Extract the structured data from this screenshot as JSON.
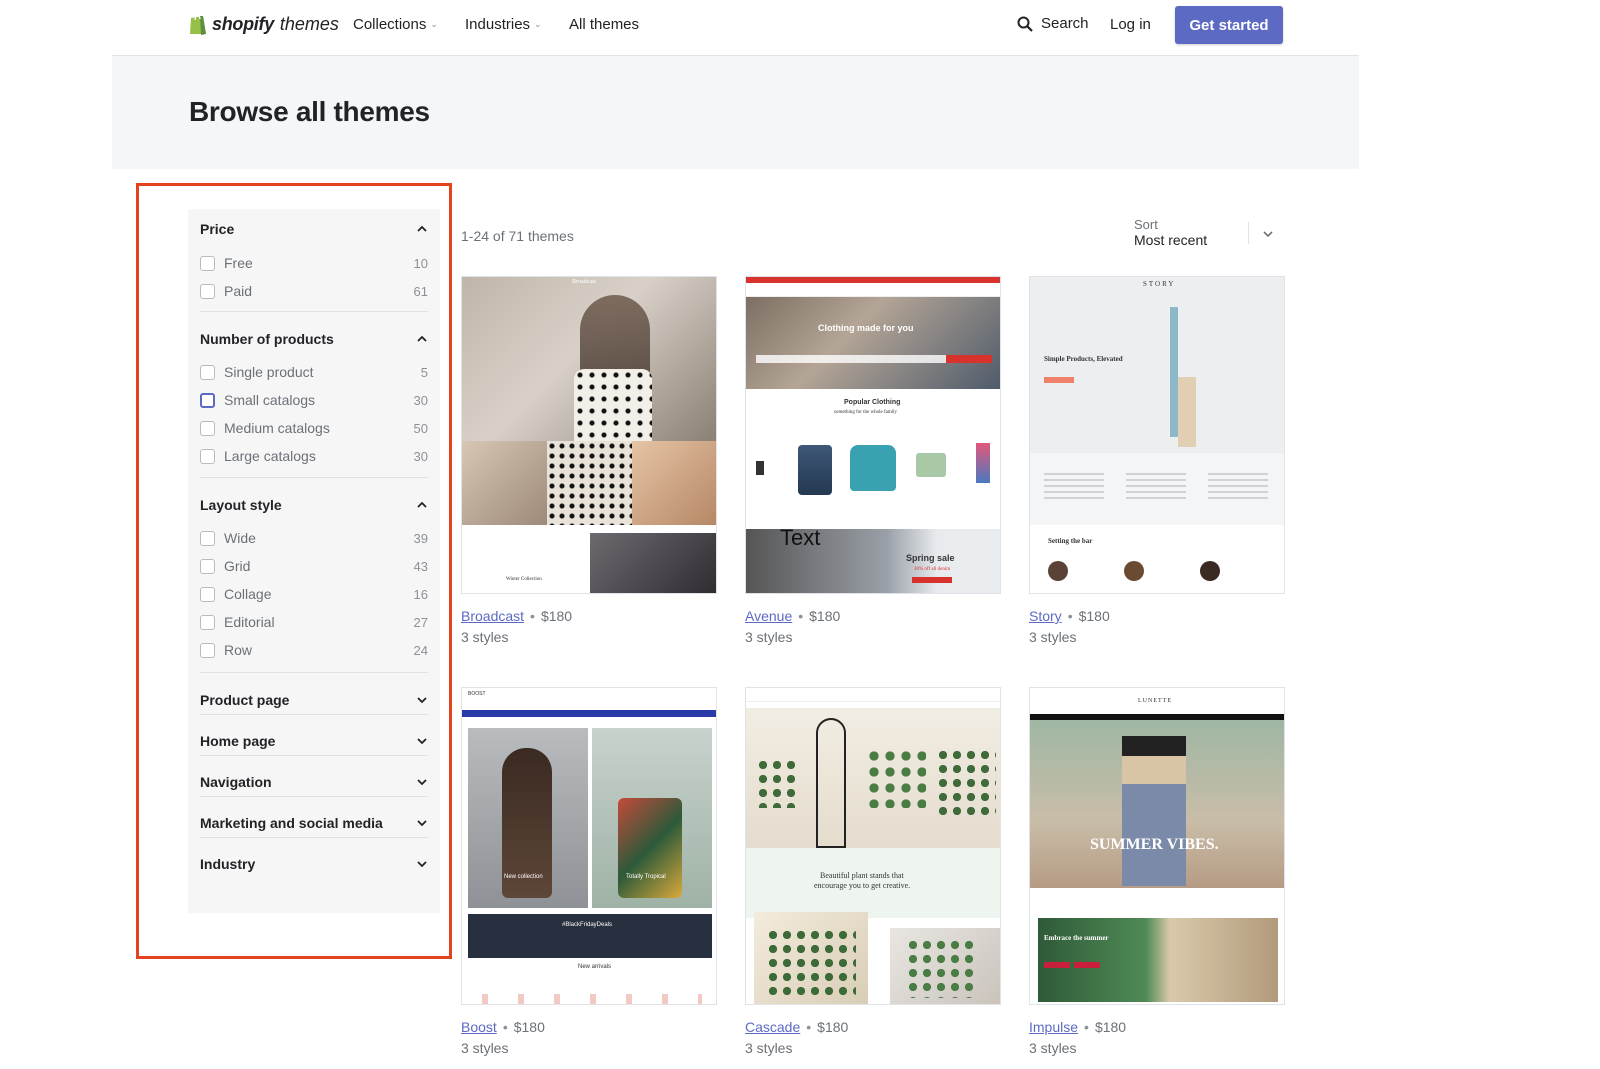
{
  "header": {
    "brand": "shopify",
    "brand_suffix": "themes",
    "nav": [
      {
        "label": "Collections",
        "has_caret": true
      },
      {
        "label": "Industries",
        "has_caret": true
      },
      {
        "label": "All themes",
        "has_caret": false
      }
    ],
    "search_label": "Search",
    "login_label": "Log in",
    "cta_label": "Get started"
  },
  "hero": {
    "title": "Browse all themes"
  },
  "filters": {
    "groups": [
      {
        "title": "Price",
        "expanded": true,
        "options": [
          {
            "label": "Free",
            "count": "10",
            "checked": false
          },
          {
            "label": "Paid",
            "count": "61",
            "checked": false
          }
        ]
      },
      {
        "title": "Number of products",
        "expanded": true,
        "options": [
          {
            "label": "Single product",
            "count": "5",
            "checked": false
          },
          {
            "label": "Small catalogs",
            "count": "30",
            "checked": false,
            "focused": true
          },
          {
            "label": "Medium catalogs",
            "count": "50",
            "checked": false
          },
          {
            "label": "Large catalogs",
            "count": "30",
            "checked": false
          }
        ]
      },
      {
        "title": "Layout style",
        "expanded": true,
        "options": [
          {
            "label": "Wide",
            "count": "39",
            "checked": false
          },
          {
            "label": "Grid",
            "count": "43",
            "checked": false
          },
          {
            "label": "Collage",
            "count": "16",
            "checked": false
          },
          {
            "label": "Editorial",
            "count": "27",
            "checked": false
          },
          {
            "label": "Row",
            "count": "24",
            "checked": false
          }
        ]
      }
    ],
    "collapsed": [
      "Product page",
      "Home page",
      "Navigation",
      "Marketing and social media",
      "Industry"
    ]
  },
  "results": {
    "count_text": "1-24 of 71 themes",
    "sort_label": "Sort",
    "sort_value": "Most recent"
  },
  "themes": [
    {
      "name": "Broadcast",
      "price": "$180",
      "styles": "3 styles"
    },
    {
      "name": "Avenue",
      "price": "$180",
      "styles": "3 styles"
    },
    {
      "name": "Story",
      "price": "$180",
      "styles": "3 styles"
    },
    {
      "name": "Boost",
      "price": "$180",
      "styles": "3 styles"
    },
    {
      "name": "Cascade",
      "price": "$180",
      "styles": "3 styles"
    },
    {
      "name": "Impulse",
      "price": "$180",
      "styles": "3 styles"
    }
  ],
  "thumb_text": {
    "avenue_hero": "Clothing made for you",
    "avenue_section": "Popular Clothing",
    "avenue_section_sub": "something for the whole family",
    "avenue_banner_word": "Text",
    "avenue_sale": "Spring sale",
    "avenue_sale_sub": "30% off all denim",
    "story_logo": "STORY",
    "story_heading": "Simple Products, Elevated",
    "story_footer": "Setting the bar",
    "boost_logo": "BOOST",
    "boost_tag1": "New collection",
    "boost_tag2": "Totally Tropical",
    "boost_banner": "#BlackFridayDeals",
    "boost_arrivals": "New arrivals",
    "cascade_text1": "Beautiful plant stands that",
    "cascade_text2": "encourage you to get creative.",
    "impulse_logo": "LUNETTE",
    "impulse_hero": "SUMMER VIBES.",
    "impulse_promo": "Embrace the summer",
    "broadcast_title": "Broadcast",
    "broadcast_promo": "Winter Collection"
  },
  "colors": {
    "accent": "#5c6ac4",
    "highlight": "#e3431f",
    "panel": "#f6f6f7",
    "hero_bg": "#f4f6f8"
  }
}
